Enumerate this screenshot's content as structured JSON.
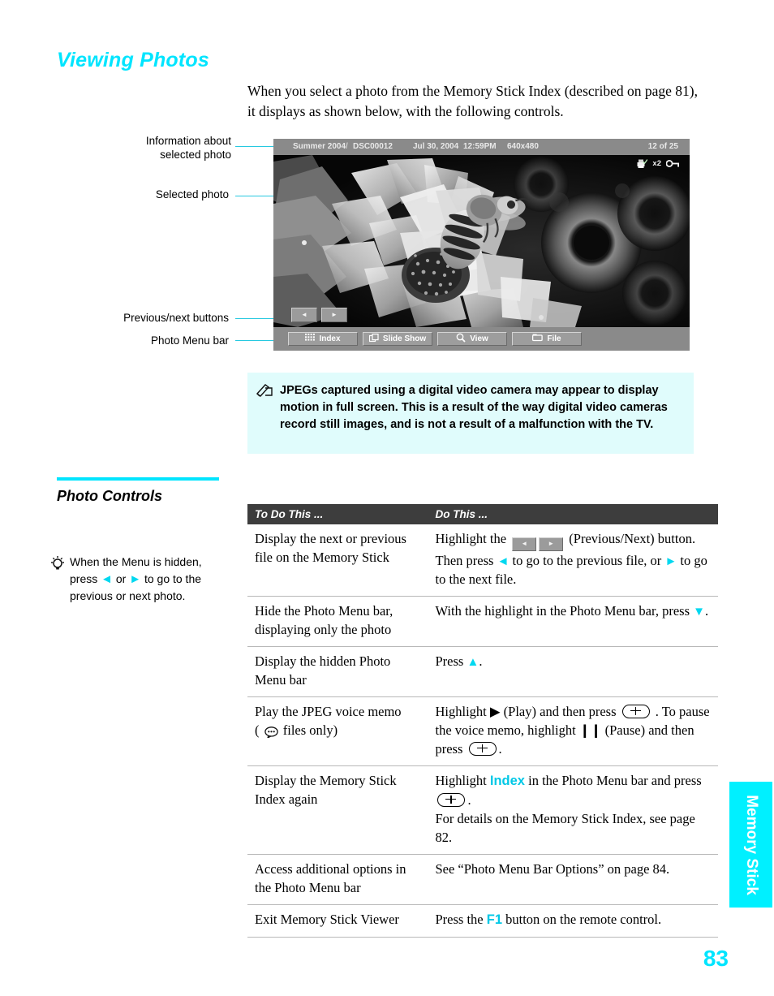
{
  "page": {
    "title": "Viewing Photos",
    "number": "83",
    "side_tab": "Memory Stick",
    "intro": "When you select a photo from the Memory Stick Index (described on page 81), it displays as shown below, with the following controls."
  },
  "callouts": [
    {
      "name": "info-about-selected-photo",
      "line1": "Information about",
      "line2": "selected photo"
    },
    {
      "name": "selected-photo",
      "line1": "Selected photo",
      "line2": ""
    },
    {
      "name": "previous-next-buttons",
      "line1": "Previous/next buttons",
      "line2": ""
    },
    {
      "name": "photo-menu-bar",
      "line1": "Photo Menu bar",
      "line2": ""
    }
  ],
  "tv": {
    "info_bar": {
      "album": "Summer 2004",
      "separator": "/",
      "file": "DSC00012",
      "date": "Jul 30, 2004",
      "time": "12:59PM",
      "dimensions": "640x480",
      "count": "12 of 25"
    },
    "badges": {
      "print_icon": "printer-check-icon",
      "copies": "x2",
      "protect_icon": "key-lock-icon"
    },
    "prev_label": "◄",
    "next_label": "►",
    "menu_bar": [
      {
        "label": "Index",
        "icon": "grid-icon"
      },
      {
        "label": "Slide Show",
        "icon": "slideshow-icon"
      },
      {
        "label": "View",
        "icon": "magnifier-icon"
      },
      {
        "label": "File",
        "icon": "file-icon"
      }
    ]
  },
  "note": {
    "icon": "note-pencil-icon",
    "text": "JPEGs captured using a digital video camera may appear to display motion in full screen. This is a result of the way digital video cameras record still images, and is not a result of a malfunction with the TV."
  },
  "section": {
    "title": "Photo Controls",
    "tip_icon": "lightbulb-icon",
    "tip": {
      "part1": "When the Menu is hidden, press",
      "part2": "or",
      "part3": "to go to the previous or next photo."
    }
  },
  "table": {
    "headers": {
      "col1": "To Do This ...",
      "col2": "Do This ..."
    },
    "rows": [
      {
        "todo_line1": "Display the next or previous",
        "todo_line2": "file on the Memory Stick",
        "do_a": "Highlight the",
        "do_b": "(Previous/Next) button.",
        "do_c": "Then press",
        "do_d": "to go to the previous file, or",
        "do_e": "to go to the next file."
      },
      {
        "todo_line1": "Hide the Photo Menu bar,",
        "todo_line2": "displaying only the photo",
        "do_a": "With the highlight in the Photo Menu bar, press",
        "do_b": "."
      },
      {
        "todo_line1": "Display the hidden Photo",
        "todo_line2": "Menu bar",
        "do_a": "Press",
        "do_b": "."
      },
      {
        "todo_line1": "Play the JPEG voice memo",
        "todo_line2a": "(",
        "todo_line2b": "files only)",
        "do_a": "Highlight ▶ (Play) and then press",
        "do_b": ". To pause the voice memo, highlight ❙❙ (Pause) and then press",
        "do_c": "."
      },
      {
        "todo_line1": "Display the Memory Stick",
        "todo_line2": "Index again",
        "do_a": "Highlight",
        "do_link": "Index",
        "do_b": "in the Photo Menu bar and press",
        "do_c": ".",
        "do_d": "For details on the Memory Stick Index, see page 82."
      },
      {
        "todo_line1": "Access additional options in",
        "todo_line2": "the Photo Menu bar",
        "do_a": "See “Photo Menu Bar Options” on page 84."
      },
      {
        "todo_line1": "Exit Memory Stick Viewer",
        "todo_line2": "",
        "do_a": "Press the",
        "do_key": "F1",
        "do_b": "button on the remote control."
      }
    ]
  },
  "colors": {
    "accent_cyan": "#00e5ff",
    "note_bg": "#e0fcfc",
    "table_header_bg": "#3d3d3d",
    "tv_chrome": "#8a8a8a"
  }
}
